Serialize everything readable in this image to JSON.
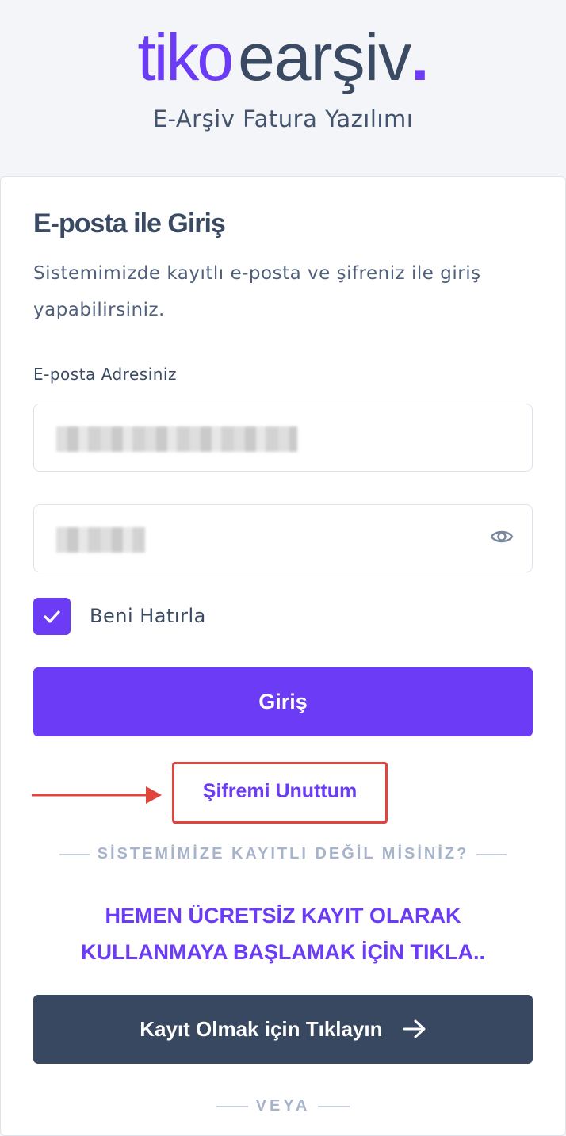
{
  "brand": {
    "logo_primary": "tiko",
    "logo_secondary": "earşiv",
    "logo_dot": ".",
    "subtitle": "E-Arşiv Fatura Yazılımı"
  },
  "colors": {
    "accent": "#6c3bf5",
    "dark_button": "#374860",
    "highlight_border": "#e0443c"
  },
  "login": {
    "title": "E-posta ile Giriş",
    "description": "Sistemimizde kayıtlı e-posta ve şifreniz ile giriş yapabilirsiniz.",
    "email_label": "E-posta Adresiniz",
    "password_icon": "eye-icon",
    "remember_label": "Beni Hatırla",
    "remember_checked": true,
    "submit_label": "Giriş",
    "forgot_label": "Şifremi Unuttum"
  },
  "register": {
    "divider_text": "SİSTEMİMİZE KAYITLI DEĞİL MİSİNİZ?",
    "cta_line1": "HEMEN ÜCRETSİZ KAYIT OLARAK",
    "cta_line2": "KULLANMAYA BAŞLAMAK İÇİN TIKLA..",
    "button_label": "Kayıt Olmak için Tıklayın",
    "button_icon": "arrow-right-icon",
    "or_text": "VEYA"
  }
}
